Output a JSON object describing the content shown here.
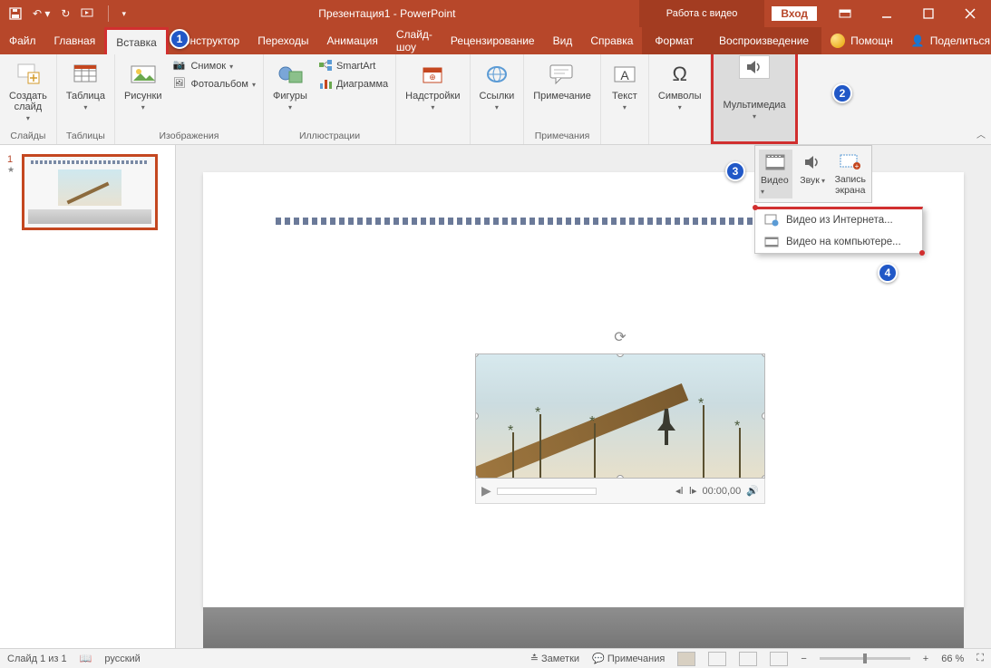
{
  "titlebar": {
    "title": "Презентация1 - PowerPoint",
    "video_tools": "Работа с видео",
    "signin": "Вход"
  },
  "tabs": {
    "file": "Файл",
    "home": "Главная",
    "insert": "Вставка",
    "design": "Конструктор",
    "transitions": "Переходы",
    "animations": "Анимация",
    "slideshow": "Слайд-шоу",
    "review": "Рецензирование",
    "view": "Вид",
    "help": "Справка",
    "format": "Формат",
    "playback": "Воспроизведение",
    "tell_me": "Помощн",
    "share": "Поделиться"
  },
  "ribbon": {
    "slides": {
      "new_slide": "Создать\nслайд",
      "group": "Слайды"
    },
    "tables": {
      "table": "Таблица",
      "group": "Таблицы"
    },
    "images": {
      "pictures": "Рисунки",
      "screenshot": "Снимок",
      "album": "Фотоальбом",
      "group": "Изображения"
    },
    "illus": {
      "shapes": "Фигуры",
      "smartart": "SmartArt",
      "chart": "Диаграмма",
      "group": "Иллюстрации"
    },
    "addins": {
      "addins": "Надстройки",
      "group": ""
    },
    "links": {
      "links": "Ссылки",
      "group": ""
    },
    "comments": {
      "comment": "Примечание",
      "group": "Примечания"
    },
    "text": {
      "text": "Текст",
      "group": ""
    },
    "symbols": {
      "symbols": "Символы",
      "group": ""
    },
    "media": {
      "media": "Мультимедиа",
      "group": ""
    }
  },
  "media_dropdown": {
    "video": "Видео",
    "audio": "Звук",
    "screenrec": "Запись\nэкрана",
    "from_internet": "Видео из Интернета...",
    "from_computer": "Видео на компьютере..."
  },
  "player": {
    "time": "00:00,00"
  },
  "thumb": {
    "num": "1"
  },
  "status": {
    "slide_of": "Слайд 1 из 1",
    "lang": "русский",
    "notes": "Заметки",
    "comments": "Примечания",
    "zoom": "66 %"
  },
  "callouts": {
    "c1": "1",
    "c2": "2",
    "c3": "3",
    "c4": "4"
  }
}
